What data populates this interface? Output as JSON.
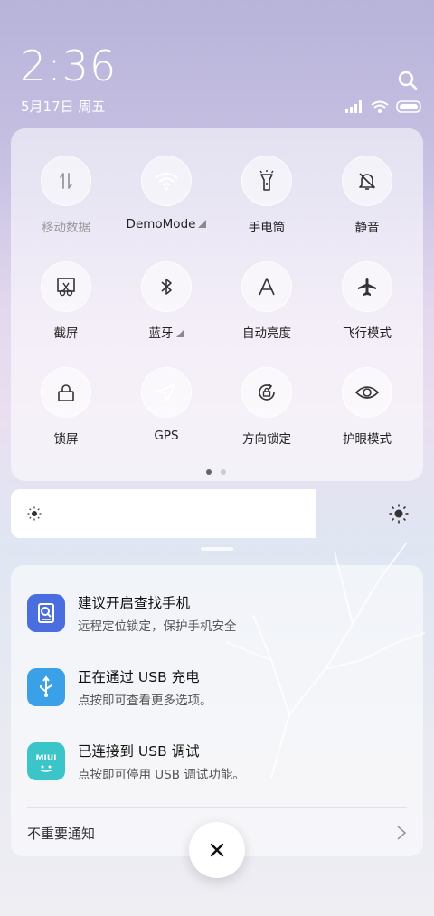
{
  "clock": {
    "time": "2:36",
    "date": "5月17日 周五"
  },
  "tiles": [
    {
      "label": "移动数据",
      "state": "off-dim",
      "icon": "mobile-data-icon"
    },
    {
      "label": "DemoMode",
      "state": "on",
      "icon": "wifi-icon",
      "has_expand": true
    },
    {
      "label": "手电筒",
      "state": "off",
      "icon": "flashlight-icon"
    },
    {
      "label": "静音",
      "state": "off",
      "icon": "bell-off-icon"
    },
    {
      "label": "截屏",
      "state": "off",
      "icon": "screenshot-icon"
    },
    {
      "label": "蓝牙",
      "state": "off",
      "icon": "bluetooth-icon",
      "has_expand": true
    },
    {
      "label": "自动亮度",
      "state": "off",
      "icon": "auto-brightness-icon"
    },
    {
      "label": "飞行模式",
      "state": "off",
      "icon": "airplane-icon"
    },
    {
      "label": "锁屏",
      "state": "off",
      "icon": "lock-icon"
    },
    {
      "label": "GPS",
      "state": "on",
      "icon": "location-arrow-icon"
    },
    {
      "label": "方向锁定",
      "state": "off",
      "icon": "rotation-lock-icon"
    },
    {
      "label": "护眼模式",
      "state": "off",
      "icon": "eye-icon"
    }
  ],
  "pager": {
    "pages": 2,
    "current": 1
  },
  "brightness": {
    "level_fraction": 0.74
  },
  "notifications": [
    {
      "title": "建议开启查找手机",
      "text": "远程定位锁定，保护手机安全",
      "icon": "find-phone-icon",
      "color": "#4a6ee0"
    },
    {
      "title": "正在通过 USB 充电",
      "text": "点按即可查看更多选项。",
      "icon": "usb-icon",
      "color": "#3aa0e8"
    },
    {
      "title": "已连接到 USB 调试",
      "text": "点按即可停用 USB 调试功能。",
      "icon": "miui-icon",
      "color": "#3cc5c8"
    }
  ],
  "unimportant_label": "不重要通知",
  "colors": {
    "accent": "#3b82f6"
  }
}
